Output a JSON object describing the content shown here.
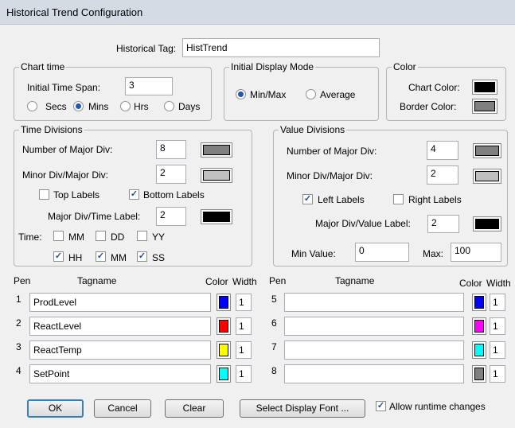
{
  "window": {
    "title": "Historical Trend Configuration"
  },
  "historical_tag": {
    "label": "Historical Tag:",
    "value": "HistTrend"
  },
  "chart_time": {
    "title": "Chart time",
    "initial_span_label": "Initial Time Span:",
    "initial_span_value": "3",
    "units": [
      {
        "label": "Secs",
        "selected": false
      },
      {
        "label": "Mins",
        "selected": true
      },
      {
        "label": "Hrs",
        "selected": false
      },
      {
        "label": "Days",
        "selected": false
      }
    ]
  },
  "display_mode": {
    "title": "Initial Display Mode",
    "options": [
      {
        "label": "Min/Max",
        "selected": true
      },
      {
        "label": "Average",
        "selected": false
      }
    ]
  },
  "color": {
    "title": "Color",
    "chart_color_label": "Chart Color:",
    "chart_color": "#000000",
    "border_color_label": "Border Color:",
    "border_color": "#808080"
  },
  "time_divisions": {
    "title": "Time Divisions",
    "major_label": "Number of Major Div:",
    "major_value": "8",
    "major_color": "#808080",
    "minor_label": "Minor Div/Major Div:",
    "minor_value": "2",
    "minor_color": "#c0c0c0",
    "top_labels": {
      "label": "Top Labels",
      "checked": false
    },
    "bottom_labels": {
      "label": "Bottom Labels",
      "checked": true
    },
    "time_label_label": "Major Div/Time Label:",
    "time_label_value": "2",
    "time_label_color": "#000000",
    "time_label": "Time:",
    "mm_date": {
      "label": "MM",
      "checked": false
    },
    "dd": {
      "label": "DD",
      "checked": false
    },
    "yy": {
      "label": "YY",
      "checked": false
    },
    "hh": {
      "label": "HH",
      "checked": true
    },
    "mm_time": {
      "label": "MM",
      "checked": true
    },
    "ss": {
      "label": "SS",
      "checked": true
    }
  },
  "value_divisions": {
    "title": "Value Divisions",
    "major_label": "Number of Major Div:",
    "major_value": "4",
    "major_color": "#808080",
    "minor_label": "Minor Div/Major Div:",
    "minor_value": "2",
    "minor_color": "#c0c0c0",
    "left_labels": {
      "label": "Left Labels",
      "checked": true
    },
    "right_labels": {
      "label": "Right Labels",
      "checked": false
    },
    "value_label_label": "Major Div/Value Label:",
    "value_label_value": "2",
    "value_label_color": "#000000",
    "min_label": "Min Value:",
    "min_value": "0",
    "max_label": "Max:",
    "max_value": "100"
  },
  "pens_header": {
    "pen": "Pen",
    "tagname": "Tagname",
    "color": "Color",
    "width": "Width"
  },
  "pens_left": [
    {
      "num": "1",
      "tag": "ProdLevel",
      "color": "#0000ff",
      "width": "1"
    },
    {
      "num": "2",
      "tag": "ReactLevel",
      "color": "#ff0000",
      "width": "1"
    },
    {
      "num": "3",
      "tag": "ReactTemp",
      "color": "#ffff00",
      "width": "1"
    },
    {
      "num": "4",
      "tag": "SetPoint",
      "color": "#00ffff",
      "width": "1"
    }
  ],
  "pens_right": [
    {
      "num": "5",
      "tag": "",
      "color": "#0000ff",
      "width": "1"
    },
    {
      "num": "6",
      "tag": "",
      "color": "#ff00ff",
      "width": "1"
    },
    {
      "num": "7",
      "tag": "",
      "color": "#00ffff",
      "width": "1"
    },
    {
      "num": "8",
      "tag": "",
      "color": "#808080",
      "width": "1"
    }
  ],
  "buttons": {
    "ok": "OK",
    "cancel": "Cancel",
    "clear": "Clear",
    "font": "Select Display Font ..."
  },
  "allow_runtime": {
    "label": "Allow runtime changes",
    "checked": true
  }
}
